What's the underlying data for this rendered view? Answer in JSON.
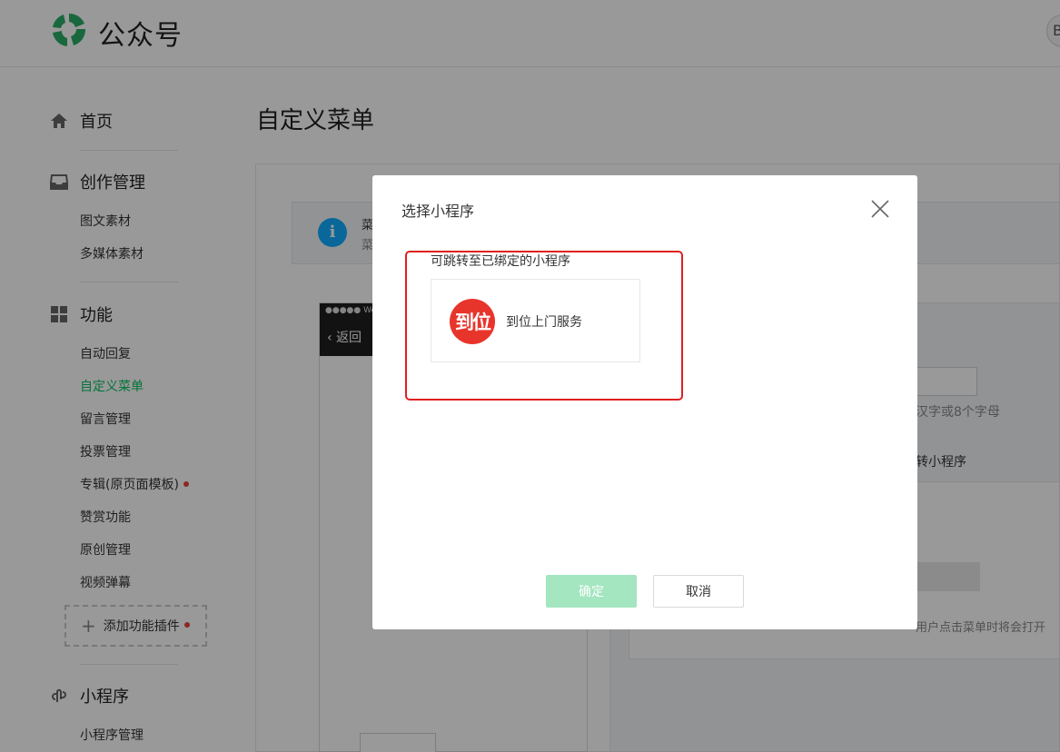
{
  "header": {
    "app_title": "公众号",
    "avatar_text": "Bi",
    "brand_color": "#07c160"
  },
  "sidebar": {
    "home": {
      "label": "首页",
      "icon": "home-icon"
    },
    "creation": {
      "label": "创作管理",
      "icon": "inbox-icon",
      "items": [
        {
          "label": "图文素材"
        },
        {
          "label": "多媒体素材"
        }
      ]
    },
    "features": {
      "label": "功能",
      "icon": "grid-icon",
      "items": [
        {
          "label": "自动回复",
          "active": false
        },
        {
          "label": "自定义菜单",
          "active": true
        },
        {
          "label": "留言管理",
          "active": false
        },
        {
          "label": "投票管理",
          "active": false
        },
        {
          "label": "专辑(原页面模板)",
          "active": false,
          "badge": true
        },
        {
          "label": "赞赏功能",
          "active": false
        },
        {
          "label": "原创管理",
          "active": false
        },
        {
          "label": "视频弹幕",
          "active": false
        }
      ],
      "add_plugin": "添加功能插件"
    },
    "miniprogram": {
      "label": "小程序",
      "icon": "link-icon",
      "items": [
        {
          "label": "小程序管理"
        }
      ]
    }
  },
  "main": {
    "page_title": "自定义菜单",
    "notice_line1": "菜",
    "notice_line2": "菜",
    "phone_carrier": "●●●●● We",
    "phone_back": "返回",
    "editor_hint": "汉字或8个字母",
    "editor_option": "转小程序",
    "editor_footer": "用户点击菜单时将会打开"
  },
  "dialog": {
    "title": "选择小程序",
    "hint": "可跳转至已绑定的小程序",
    "apps": [
      {
        "logo_text": "到位",
        "name": "到位上门服务"
      }
    ],
    "confirm_label": "确定",
    "cancel_label": "取消"
  }
}
